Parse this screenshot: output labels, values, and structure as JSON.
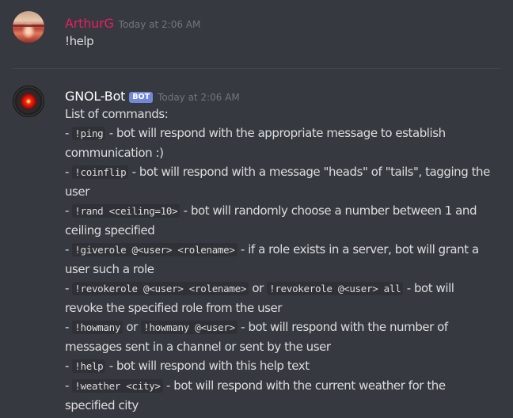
{
  "messages": [
    {
      "username": "ArthurG",
      "username_color": "#e91e63",
      "timestamp": "Today at 2:06 AM",
      "avatar": "sunset-avatar",
      "text": "!help"
    },
    {
      "username": "GNOL-Bot",
      "username_color": "#ffffff",
      "badge": "BOT",
      "timestamp": "Today at 2:06 AM",
      "avatar": "hal-9000-eye-avatar",
      "intro": "List of commands:",
      "commands": [
        {
          "cmd": "!ping",
          "desc": "bot will respond with the appropriate message to establish",
          "desc2": "communication :)"
        },
        {
          "cmd": "!coinflip",
          "desc": "bot will respond with a message \"heads\" of \"tails\", tagging the",
          "desc2": "user"
        },
        {
          "cmd": "!rand <ceiling=10>",
          "desc": "bot will randomly choose a number between 1 and",
          "desc2": "ceiling specified"
        },
        {
          "cmd": "!giverole @<user> <rolename>",
          "desc": "if a role exists in a server, bot will grant a",
          "desc2": "user such a role"
        },
        {
          "cmd": "!revokerole @<user> <rolename>",
          "or": "or",
          "cmd_alt": "!revokerole @<user> all",
          "desc": "bot will",
          "desc2": "revoke the specified role from the user"
        },
        {
          "cmd": "!howmany",
          "or": "or",
          "cmd_alt": "!howmany @<user>",
          "desc": "bot will respond with the number of",
          "desc2": "messages sent in a channel or sent by the user"
        },
        {
          "cmd": "!help",
          "desc": "bot will respond with this help text"
        },
        {
          "cmd": "!weather <city>",
          "desc": "bot will respond with the current weather for the",
          "desc2": "specified city"
        }
      ]
    }
  ]
}
